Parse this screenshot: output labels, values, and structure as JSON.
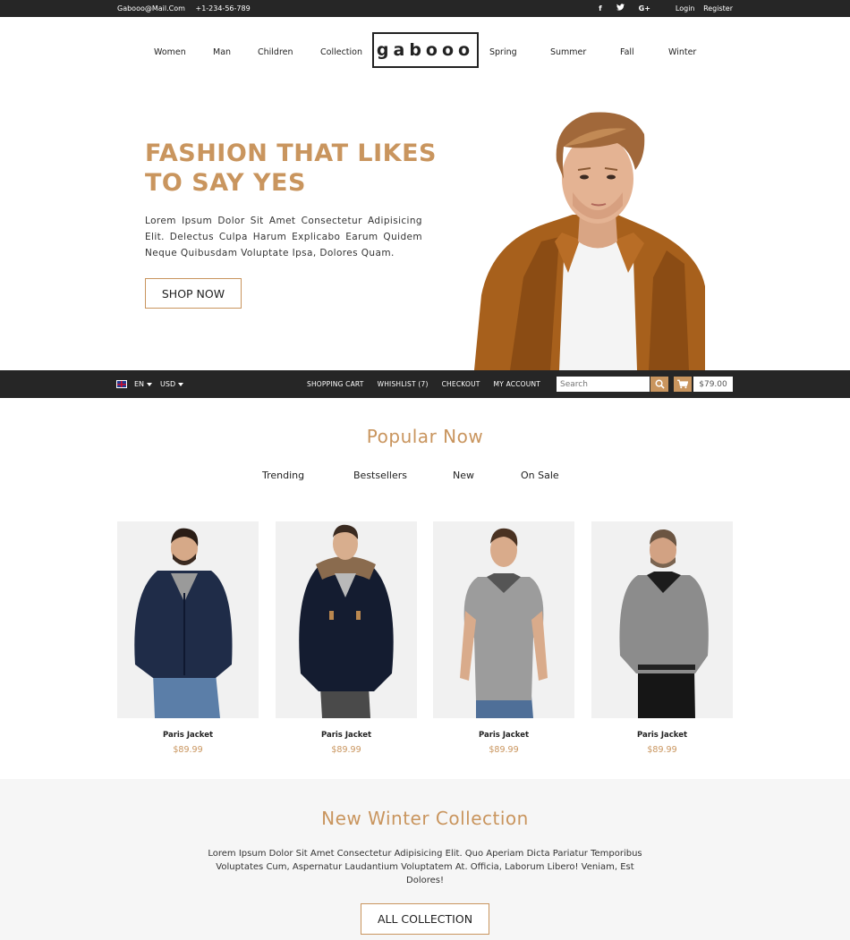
{
  "topbar": {
    "email": "Gabooo@Mail.Com",
    "phone": "+1-234-56-789",
    "social": [
      "f",
      "t",
      "G+"
    ],
    "login": "Login",
    "register": "Register"
  },
  "nav": {
    "left": [
      "Women",
      "Man",
      "Children",
      "Collection"
    ],
    "logo": "gabooo",
    "right": [
      "Spring",
      "Summer",
      "Fall",
      "Winter"
    ]
  },
  "hero": {
    "title": "FASHION THAT LIKES TO SAY YES",
    "text": "Lorem Ipsum Dolor Sit Amet Consectetur Adipisicing Elit. Delectus Culpa Harum Explicabo Earum Quidem Neque Quibusdam Voluptate Ipsa, Dolores Quam.",
    "button": "SHOP NOW"
  },
  "shopbar": {
    "language": "EN",
    "currency": "USD",
    "links": [
      "SHOPPING CART",
      "WHISHLIST (7)",
      "CHECKOUT",
      "MY ACCOUNT"
    ],
    "search_placeholder": "Search",
    "cart_total": "$79.00"
  },
  "popular": {
    "title": "Popular Now",
    "tabs": [
      "Trending",
      "Bestsellers",
      "New",
      "On Sale"
    ],
    "products": [
      {
        "name": "Paris Jacket",
        "price": "$89.99"
      },
      {
        "name": "Paris Jacket",
        "price": "$89.99"
      },
      {
        "name": "Paris Jacket",
        "price": "$89.99"
      },
      {
        "name": "Paris Jacket",
        "price": "$89.99"
      }
    ]
  },
  "winter": {
    "title": "New Winter Collection",
    "text": "Lorem Ipsum Dolor Sit Amet Consectetur Adipisicing Elit. Quo Aperiam Dicta Pariatur Temporibus Voluptates Cum, Aspernatur Laudantium Voluptatem At. Officia, Laborum Libero! Veniam, Est Dolores!",
    "button": "ALL COLLECTION"
  },
  "colors": {
    "accent": "#c9955e",
    "dark_bar": "#262626"
  }
}
